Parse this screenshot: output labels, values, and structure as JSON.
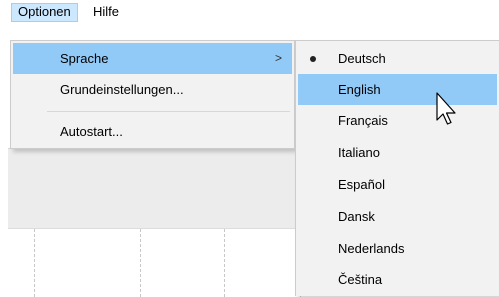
{
  "menubar": {
    "items": [
      {
        "label": "Optionen",
        "active": true
      },
      {
        "label": "Hilfe",
        "active": false
      }
    ]
  },
  "options_menu": {
    "items": [
      {
        "label": "Sprache",
        "has_submenu": true,
        "highlighted": true
      },
      {
        "label": "Grundeinstellungen...",
        "has_submenu": false,
        "highlighted": false
      },
      {
        "label": "Autostart...",
        "has_submenu": false,
        "highlighted": false
      }
    ],
    "submenu_arrow": ">"
  },
  "language_menu": {
    "selected": "Deutsch",
    "hovered": "English",
    "items": [
      {
        "label": "Deutsch"
      },
      {
        "label": "English"
      },
      {
        "label": "Français"
      },
      {
        "label": "Italiano"
      },
      {
        "label": "Español"
      },
      {
        "label": "Dansk"
      },
      {
        "label": "Nederlands"
      },
      {
        "label": "Čeština"
      }
    ]
  },
  "icons": {
    "cursor": "mouse-pointer-icon",
    "submenu": "chevron-right-icon",
    "selected": "radio-bullet-icon"
  },
  "colors": {
    "highlight": "#91c9f7",
    "menubar_active": "#cce8ff",
    "menu_bg": "#f2f2f2"
  }
}
